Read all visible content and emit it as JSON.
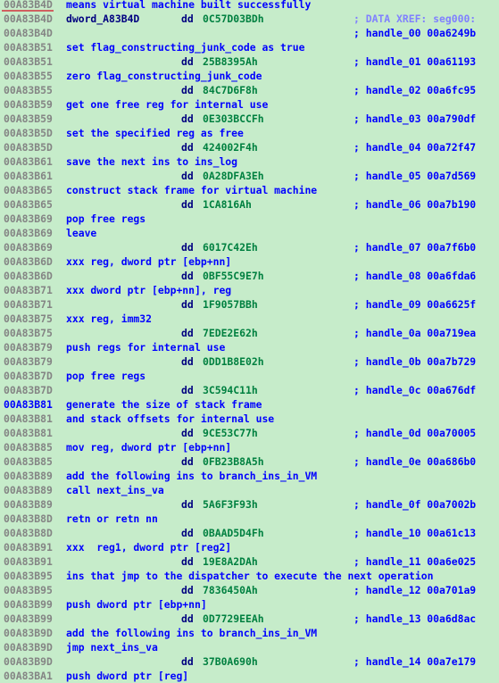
{
  "colors": {
    "background": "#c6ecca",
    "address": "#848484",
    "address_selected": "#0000ff",
    "comment": "#0000ff",
    "keyword": "#000080",
    "number": "#008040",
    "xref": "#8080ff",
    "cursor_underline": "#d06060"
  },
  "rows": [
    {
      "addr": "00A83B4D",
      "type": "comment",
      "text": "means virtual machine built successfully",
      "underline": true
    },
    {
      "addr": "00A83B4D",
      "type": "data",
      "label": "dword_A83B4D",
      "kw": "dd",
      "value": "0C57D03BDh",
      "rcomment": "; DATA XREF: seg000:",
      "xref": true
    },
    {
      "addr": "00A83B4D",
      "type": "data",
      "rcomment": "; handle_00 00a6249b"
    },
    {
      "addr": "00A83B51",
      "type": "comment",
      "text": "set flag_constructing_junk_code as true"
    },
    {
      "addr": "00A83B51",
      "type": "data",
      "kw": "dd",
      "value": "25B8395Ah",
      "rcomment": "; handle_01 00a61193"
    },
    {
      "addr": "00A83B55",
      "type": "comment",
      "text": "zero flag_constructing_junk_code"
    },
    {
      "addr": "00A83B55",
      "type": "data",
      "kw": "dd",
      "value": "84C7D6F8h",
      "rcomment": "; handle_02 00a6fc95"
    },
    {
      "addr": "00A83B59",
      "type": "comment",
      "text": "get one free reg for internal use"
    },
    {
      "addr": "00A83B59",
      "type": "data",
      "kw": "dd",
      "value": "0E303BCCFh",
      "rcomment": "; handle_03 00a790df"
    },
    {
      "addr": "00A83B5D",
      "type": "comment",
      "text": "set the specified reg as free"
    },
    {
      "addr": "00A83B5D",
      "type": "data",
      "kw": "dd",
      "value": "424002F4h",
      "rcomment": "; handle_04 00a72f47"
    },
    {
      "addr": "00A83B61",
      "type": "comment",
      "text": "save the next ins to ins_log"
    },
    {
      "addr": "00A83B61",
      "type": "data",
      "kw": "dd",
      "value": "0A28DFA3Eh",
      "rcomment": "; handle_05 00a7d569"
    },
    {
      "addr": "00A83B65",
      "type": "comment",
      "text": "construct stack frame for virtual machine"
    },
    {
      "addr": "00A83B65",
      "type": "data",
      "kw": "dd",
      "value": "1CA816Ah",
      "rcomment": "; handle_06 00a7b190"
    },
    {
      "addr": "00A83B69",
      "type": "comment",
      "text": "pop free regs"
    },
    {
      "addr": "00A83B69",
      "type": "comment",
      "text": "leave"
    },
    {
      "addr": "00A83B69",
      "type": "data",
      "kw": "dd",
      "value": "6017C42Eh",
      "rcomment": "; handle_07 00a7f6b0"
    },
    {
      "addr": "00A83B6D",
      "type": "comment",
      "text": "xxx reg, dword ptr [ebp+nn]"
    },
    {
      "addr": "00A83B6D",
      "type": "data",
      "kw": "dd",
      "value": "0BF55C9E7h",
      "rcomment": "; handle_08 00a6fda6"
    },
    {
      "addr": "00A83B71",
      "type": "comment",
      "text": "xxx dword ptr [ebp+nn], reg"
    },
    {
      "addr": "00A83B71",
      "type": "data",
      "kw": "dd",
      "value": "1F9057BBh",
      "rcomment": "; handle_09 00a6625f"
    },
    {
      "addr": "00A83B75",
      "type": "comment",
      "text": "xxx reg, imm32"
    },
    {
      "addr": "00A83B75",
      "type": "data",
      "kw": "dd",
      "value": "7EDE2E62h",
      "rcomment": "; handle_0a 00a719ea"
    },
    {
      "addr": "00A83B79",
      "type": "comment",
      "text": "push regs for internal use"
    },
    {
      "addr": "00A83B79",
      "type": "data",
      "kw": "dd",
      "value": "0DD1B8E02h",
      "rcomment": "; handle_0b 00a7b729"
    },
    {
      "addr": "00A83B7D",
      "type": "comment",
      "text": "pop free regs"
    },
    {
      "addr": "00A83B7D",
      "type": "data",
      "kw": "dd",
      "value": "3C594C11h",
      "rcomment": "; handle_0c 00a676df"
    },
    {
      "addr": "00A83B81",
      "type": "comment",
      "text": "generate the size of stack frame",
      "selected": true
    },
    {
      "addr": "00A83B81",
      "type": "comment",
      "text": "and stack offsets for internal use"
    },
    {
      "addr": "00A83B81",
      "type": "data",
      "kw": "dd",
      "value": "9CE53C77h",
      "rcomment": "; handle_0d 00a70005"
    },
    {
      "addr": "00A83B85",
      "type": "comment",
      "text": "mov reg, dword ptr [ebp+nn]"
    },
    {
      "addr": "00A83B85",
      "type": "data",
      "kw": "dd",
      "value": "0FB23B8A5h",
      "rcomment": "; handle_0e 00a686b0"
    },
    {
      "addr": "00A83B89",
      "type": "comment",
      "text": "add the following ins to branch_ins_in_VM"
    },
    {
      "addr": "00A83B89",
      "type": "comment",
      "text": "call next_ins_va"
    },
    {
      "addr": "00A83B89",
      "type": "data",
      "kw": "dd",
      "value": "5A6F3F93h",
      "rcomment": "; handle_0f 00a7002b"
    },
    {
      "addr": "00A83B8D",
      "type": "comment",
      "text": "retn or retn nn"
    },
    {
      "addr": "00A83B8D",
      "type": "data",
      "kw": "dd",
      "value": "0BAAD5D4Fh",
      "rcomment": "; handle_10 00a61c13"
    },
    {
      "addr": "00A83B91",
      "type": "comment",
      "text": "xxx  reg1, dword ptr [reg2]"
    },
    {
      "addr": "00A83B91",
      "type": "data",
      "kw": "dd",
      "value": "19E8A2DAh",
      "rcomment": "; handle_11 00a6e025"
    },
    {
      "addr": "00A83B95",
      "type": "comment",
      "text": "ins that jmp to the dispatcher to execute the next operation"
    },
    {
      "addr": "00A83B95",
      "type": "data",
      "kw": "dd",
      "value": "7836450Ah",
      "rcomment": "; handle_12 00a701a9"
    },
    {
      "addr": "00A83B99",
      "type": "comment",
      "text": "push dword ptr [ebp+nn]"
    },
    {
      "addr": "00A83B99",
      "type": "data",
      "kw": "dd",
      "value": "0D7729EEAh",
      "rcomment": "; handle_13 00a6d8ac"
    },
    {
      "addr": "00A83B9D",
      "type": "comment",
      "text": "add the following ins to branch_ins_in_VM"
    },
    {
      "addr": "00A83B9D",
      "type": "comment",
      "text": "jmp next_ins_va"
    },
    {
      "addr": "00A83B9D",
      "type": "data",
      "kw": "dd",
      "value": "37B0A690h",
      "rcomment": "; handle_14 00a7e179"
    },
    {
      "addr": "00A83BA1",
      "type": "comment",
      "text": "push dword ptr [reg]"
    }
  ]
}
